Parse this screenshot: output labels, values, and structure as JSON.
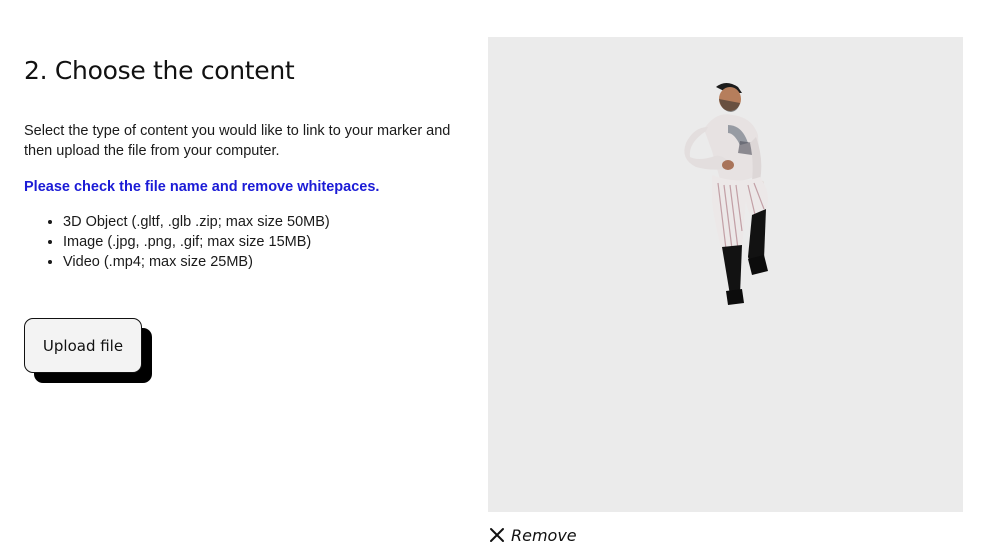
{
  "section": {
    "title": "2. Choose the content",
    "description": "Select the type of content you would like to link to your marker and then upload the file from your computer.",
    "warning": "Please check the file name and remove whitepaces.",
    "file_types": [
      "3D Object (.gltf, .glb .zip; max size 50MB)",
      "Image (.jpg, .png, .gif; max size 15MB)",
      "Video (.mp4; max size 25MB)"
    ],
    "upload_label": "Upload file"
  },
  "preview": {
    "background": "#ebebeb",
    "remove_label": "Remove",
    "remove_icon": "close-icon"
  },
  "colors": {
    "warning": "#1b1bd6",
    "button_bg": "#f3f3f3",
    "button_shadow": "#000000"
  }
}
